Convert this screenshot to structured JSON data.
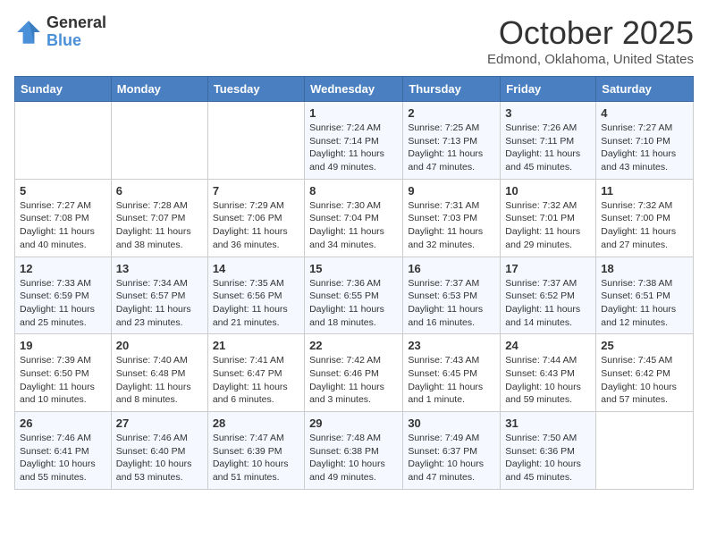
{
  "header": {
    "logo": {
      "line1": "General",
      "line2": "Blue"
    },
    "title": "October 2025",
    "subtitle": "Edmond, Oklahoma, United States"
  },
  "days_of_week": [
    "Sunday",
    "Monday",
    "Tuesday",
    "Wednesday",
    "Thursday",
    "Friday",
    "Saturday"
  ],
  "weeks": [
    [
      {
        "num": "",
        "info": ""
      },
      {
        "num": "",
        "info": ""
      },
      {
        "num": "",
        "info": ""
      },
      {
        "num": "1",
        "info": "Sunrise: 7:24 AM\nSunset: 7:14 PM\nDaylight: 11 hours and 49 minutes."
      },
      {
        "num": "2",
        "info": "Sunrise: 7:25 AM\nSunset: 7:13 PM\nDaylight: 11 hours and 47 minutes."
      },
      {
        "num": "3",
        "info": "Sunrise: 7:26 AM\nSunset: 7:11 PM\nDaylight: 11 hours and 45 minutes."
      },
      {
        "num": "4",
        "info": "Sunrise: 7:27 AM\nSunset: 7:10 PM\nDaylight: 11 hours and 43 minutes."
      }
    ],
    [
      {
        "num": "5",
        "info": "Sunrise: 7:27 AM\nSunset: 7:08 PM\nDaylight: 11 hours and 40 minutes."
      },
      {
        "num": "6",
        "info": "Sunrise: 7:28 AM\nSunset: 7:07 PM\nDaylight: 11 hours and 38 minutes."
      },
      {
        "num": "7",
        "info": "Sunrise: 7:29 AM\nSunset: 7:06 PM\nDaylight: 11 hours and 36 minutes."
      },
      {
        "num": "8",
        "info": "Sunrise: 7:30 AM\nSunset: 7:04 PM\nDaylight: 11 hours and 34 minutes."
      },
      {
        "num": "9",
        "info": "Sunrise: 7:31 AM\nSunset: 7:03 PM\nDaylight: 11 hours and 32 minutes."
      },
      {
        "num": "10",
        "info": "Sunrise: 7:32 AM\nSunset: 7:01 PM\nDaylight: 11 hours and 29 minutes."
      },
      {
        "num": "11",
        "info": "Sunrise: 7:32 AM\nSunset: 7:00 PM\nDaylight: 11 hours and 27 minutes."
      }
    ],
    [
      {
        "num": "12",
        "info": "Sunrise: 7:33 AM\nSunset: 6:59 PM\nDaylight: 11 hours and 25 minutes."
      },
      {
        "num": "13",
        "info": "Sunrise: 7:34 AM\nSunset: 6:57 PM\nDaylight: 11 hours and 23 minutes."
      },
      {
        "num": "14",
        "info": "Sunrise: 7:35 AM\nSunset: 6:56 PM\nDaylight: 11 hours and 21 minutes."
      },
      {
        "num": "15",
        "info": "Sunrise: 7:36 AM\nSunset: 6:55 PM\nDaylight: 11 hours and 18 minutes."
      },
      {
        "num": "16",
        "info": "Sunrise: 7:37 AM\nSunset: 6:53 PM\nDaylight: 11 hours and 16 minutes."
      },
      {
        "num": "17",
        "info": "Sunrise: 7:37 AM\nSunset: 6:52 PM\nDaylight: 11 hours and 14 minutes."
      },
      {
        "num": "18",
        "info": "Sunrise: 7:38 AM\nSunset: 6:51 PM\nDaylight: 11 hours and 12 minutes."
      }
    ],
    [
      {
        "num": "19",
        "info": "Sunrise: 7:39 AM\nSunset: 6:50 PM\nDaylight: 11 hours and 10 minutes."
      },
      {
        "num": "20",
        "info": "Sunrise: 7:40 AM\nSunset: 6:48 PM\nDaylight: 11 hours and 8 minutes."
      },
      {
        "num": "21",
        "info": "Sunrise: 7:41 AM\nSunset: 6:47 PM\nDaylight: 11 hours and 6 minutes."
      },
      {
        "num": "22",
        "info": "Sunrise: 7:42 AM\nSunset: 6:46 PM\nDaylight: 11 hours and 3 minutes."
      },
      {
        "num": "23",
        "info": "Sunrise: 7:43 AM\nSunset: 6:45 PM\nDaylight: 11 hours and 1 minute."
      },
      {
        "num": "24",
        "info": "Sunrise: 7:44 AM\nSunset: 6:43 PM\nDaylight: 10 hours and 59 minutes."
      },
      {
        "num": "25",
        "info": "Sunrise: 7:45 AM\nSunset: 6:42 PM\nDaylight: 10 hours and 57 minutes."
      }
    ],
    [
      {
        "num": "26",
        "info": "Sunrise: 7:46 AM\nSunset: 6:41 PM\nDaylight: 10 hours and 55 minutes."
      },
      {
        "num": "27",
        "info": "Sunrise: 7:46 AM\nSunset: 6:40 PM\nDaylight: 10 hours and 53 minutes."
      },
      {
        "num": "28",
        "info": "Sunrise: 7:47 AM\nSunset: 6:39 PM\nDaylight: 10 hours and 51 minutes."
      },
      {
        "num": "29",
        "info": "Sunrise: 7:48 AM\nSunset: 6:38 PM\nDaylight: 10 hours and 49 minutes."
      },
      {
        "num": "30",
        "info": "Sunrise: 7:49 AM\nSunset: 6:37 PM\nDaylight: 10 hours and 47 minutes."
      },
      {
        "num": "31",
        "info": "Sunrise: 7:50 AM\nSunset: 6:36 PM\nDaylight: 10 hours and 45 minutes."
      },
      {
        "num": "",
        "info": ""
      }
    ]
  ]
}
